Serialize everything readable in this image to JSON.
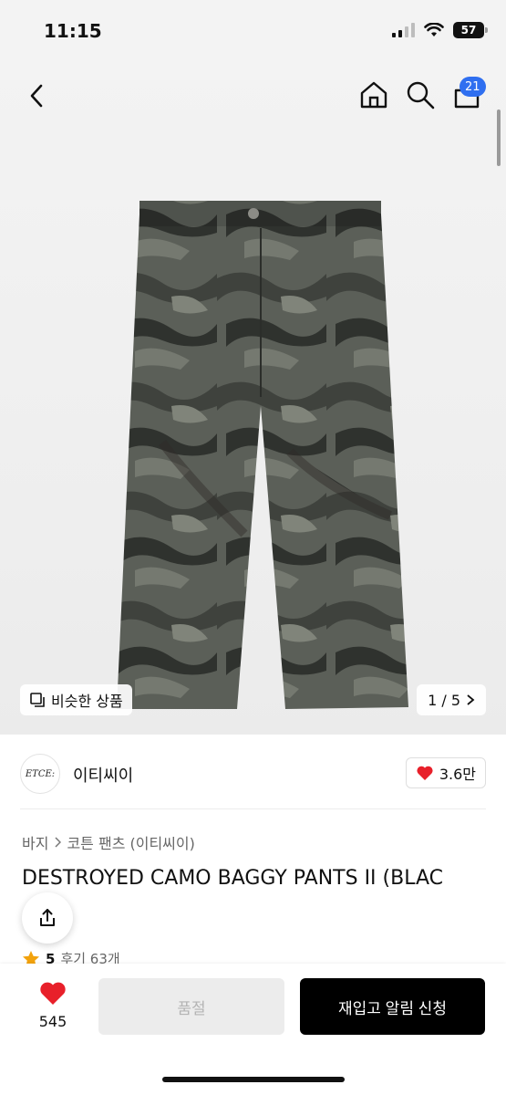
{
  "status_bar": {
    "time": "11:15",
    "battery": "57"
  },
  "header": {
    "cart_count": "21"
  },
  "gallery": {
    "similar_label": "비슷한 상품",
    "page_indicator": "1 / 5"
  },
  "brand": {
    "logo_text": "ETCE:",
    "name": "이티씨이",
    "likes": "3.6만"
  },
  "breadcrumb": {
    "category": "바지",
    "subcategory": "코튼 팬츠 (이티씨이)"
  },
  "product": {
    "title": "DESTROYED CAMO BAGGY PANTS II (BLAC",
    "rating": "5",
    "reviews": "후기 63개"
  },
  "bottom_bar": {
    "wish_count": "545",
    "soldout_label": "품절",
    "restock_label": "재입고 알림 신청"
  },
  "colors": {
    "accent_blue": "#2f6ff0",
    "heart_red": "#e8202a",
    "star_orange": "#f2a20c"
  }
}
